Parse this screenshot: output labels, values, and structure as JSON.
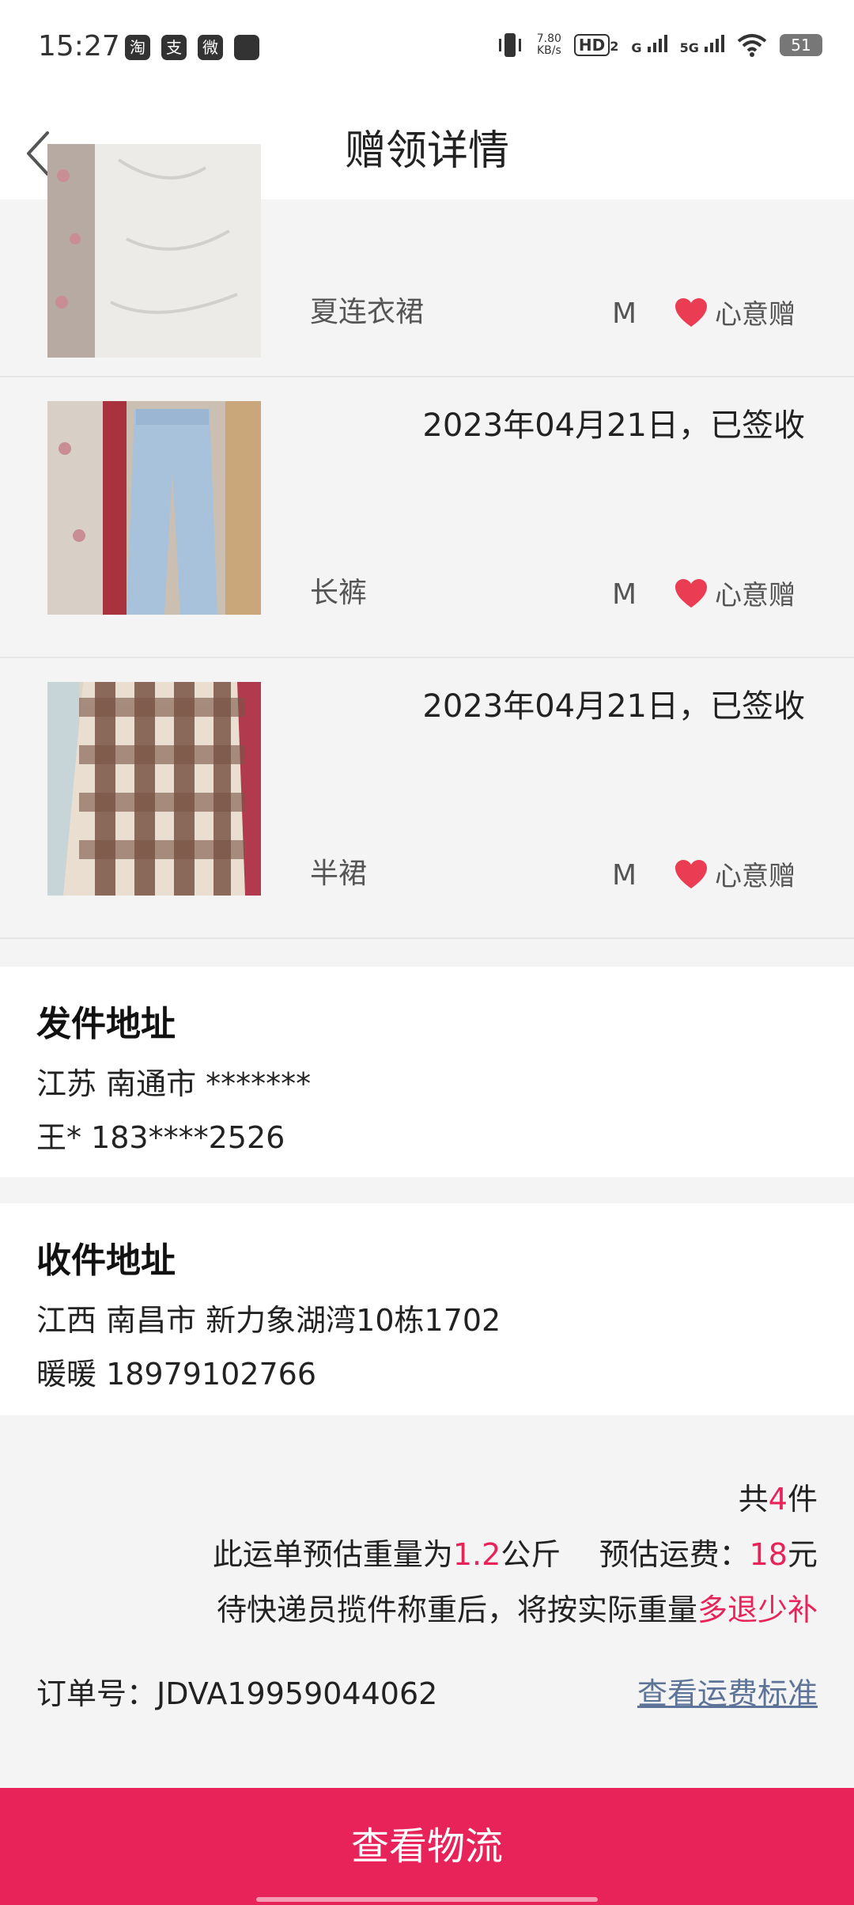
{
  "status_bar": {
    "time": "15:27",
    "apps": [
      "淘",
      "支",
      "微",
      ""
    ],
    "net_speed_value": "7.80",
    "net_speed_unit": "KB/s",
    "hd_label": "HD",
    "hd_sub": "2",
    "sig1_label": "G",
    "sig2_label": "5G",
    "battery": "51"
  },
  "header": {
    "title": "赠领详情"
  },
  "items": [
    {
      "date": "",
      "name": "夏连衣裙",
      "size": "M",
      "tag": "心意赠"
    },
    {
      "date": "2023年04月21日，已签收",
      "name": "长裤",
      "size": "M",
      "tag": "心意赠"
    },
    {
      "date": "2023年04月21日，已签收",
      "name": "半裙",
      "size": "M",
      "tag": "心意赠"
    }
  ],
  "sender": {
    "title": "发件地址",
    "address": "江苏 南通市 *******",
    "contact": "王* 183****2526"
  },
  "receiver": {
    "title": "收件地址",
    "address": "江西 南昌市 新力象湖湾10栋1702",
    "contact": "暖暖 18979102766"
  },
  "summary": {
    "total_prefix": "共",
    "total_count": "4",
    "total_suffix": "件",
    "weight_prefix": "此运单预估重量为",
    "weight_value": "1.2",
    "weight_unit": "公斤",
    "fee_prefix": "预估运费：",
    "fee_value": "18",
    "fee_unit": "元",
    "note_prefix": "待快递员揽件称重后，将按实际重量",
    "note_highlight": "多退少补",
    "order_label": "订单号：JDVA19959044062",
    "fee_standard_link": "查看运费标准"
  },
  "bottom": {
    "button_label": "查看物流"
  },
  "colors": {
    "accent": "#e8235a",
    "link": "#5d7498"
  }
}
